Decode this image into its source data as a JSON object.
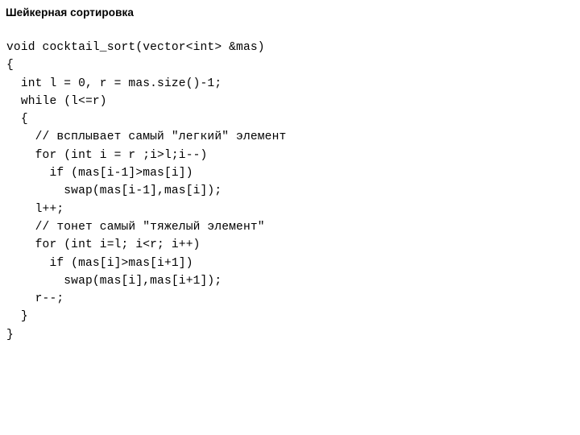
{
  "slide": {
    "title": "Шейкерная сортировка",
    "background_color": "#ffffff",
    "text_color": "#000000"
  },
  "code": {
    "language": "C++",
    "lines": [
      "void cocktail_sort(vector<int> &mas)",
      "{",
      "  int l = 0, r = mas.size()-1;",
      "  while (l<=r)",
      "  {",
      "    // всплывает самый \"легкий\" элемент",
      "    for (int i = r ;i>l;i--)",
      "      if (mas[i-1]>mas[i])",
      "        swap(mas[i-1],mas[i]);",
      "    l++;",
      "    // тонет самый \"тяжелый элемент\"",
      "    for (int i=l; i<r; i++)",
      "      if (mas[i]>mas[i+1])",
      "        swap(mas[i],mas[i+1]);",
      "    r--;",
      "  }",
      "}"
    ]
  }
}
